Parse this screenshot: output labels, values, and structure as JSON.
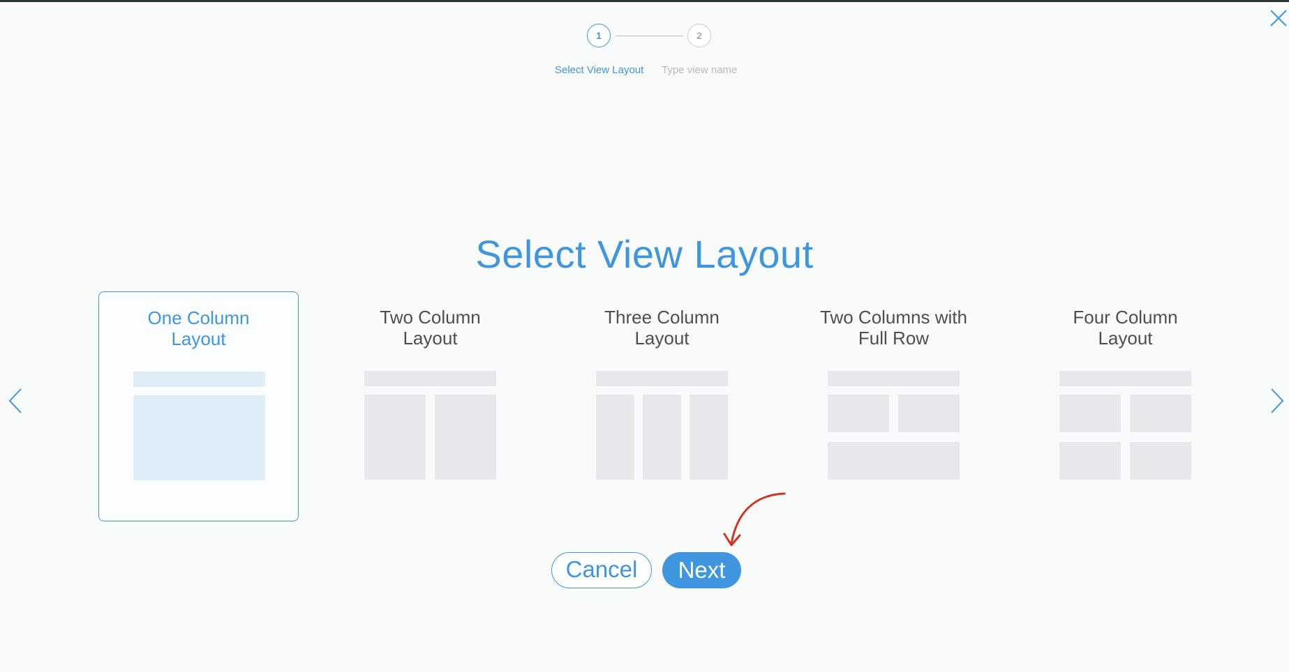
{
  "stepper": {
    "steps": [
      {
        "number": "1",
        "label": "Select View Layout",
        "state": "active"
      },
      {
        "number": "2",
        "label": "Type view name",
        "state": "inactive"
      }
    ]
  },
  "title": "Select View Layout",
  "layouts": [
    {
      "line1": "One Column",
      "line2": "Layout",
      "selected": true
    },
    {
      "line1": "Two Column",
      "line2": "Layout",
      "selected": false
    },
    {
      "line1": "Three Column",
      "line2": "Layout",
      "selected": false
    },
    {
      "line1": "Two Columns with",
      "line2": "Full Row",
      "selected": false
    },
    {
      "line1": "Four Column",
      "line2": "Layout",
      "selected": false
    }
  ],
  "buttons": {
    "cancel_label": "Cancel",
    "next_label": "Next"
  },
  "icons": {
    "close": "close-icon",
    "prev": "chevron-left-icon",
    "next": "chevron-right-icon"
  },
  "colors": {
    "accent": "#3f95de",
    "annotation": "#d0341e",
    "placeholder_block": "#e8e8ec",
    "placeholder_block_selected": "#deedf7"
  }
}
